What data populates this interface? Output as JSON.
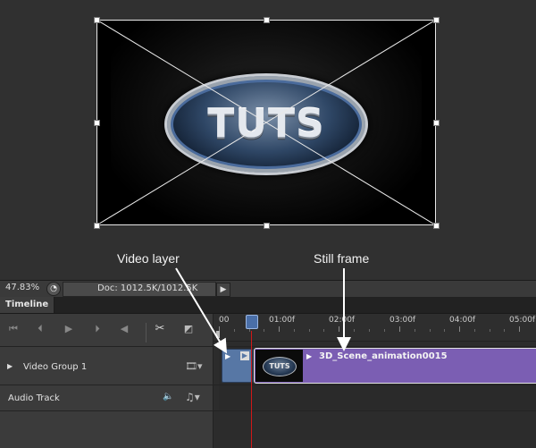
{
  "canvas": {
    "logo_text": "TUTS",
    "annotations": {
      "video_layer": "Video layer",
      "still_frame": "Still frame"
    }
  },
  "status_bar": {
    "zoom": "47.83%",
    "doc_size": "Doc: 1012.5K/1012.5K"
  },
  "timeline": {
    "tab_label": "Timeline",
    "ruler": {
      "labels": [
        "00",
        "01:00f",
        "02:00f",
        "03:00f",
        "04:00f",
        "05:00f"
      ]
    },
    "tracks": {
      "video_group": "Video Group 1",
      "audio_track": "Audio Track"
    },
    "clips": {
      "main_clip_name": "3D_Scene_animation0015"
    }
  },
  "colors": {
    "video_clip": "#7b5eb3",
    "selected_clip": "#5777a5",
    "playhead": "#d01818"
  },
  "icons": [
    "scissors-icon",
    "transition-icon",
    "film-icon",
    "speaker-icon",
    "music-note-icon",
    "play-icon",
    "go-to-first-icon",
    "step-back-icon",
    "step-forward-icon"
  ]
}
